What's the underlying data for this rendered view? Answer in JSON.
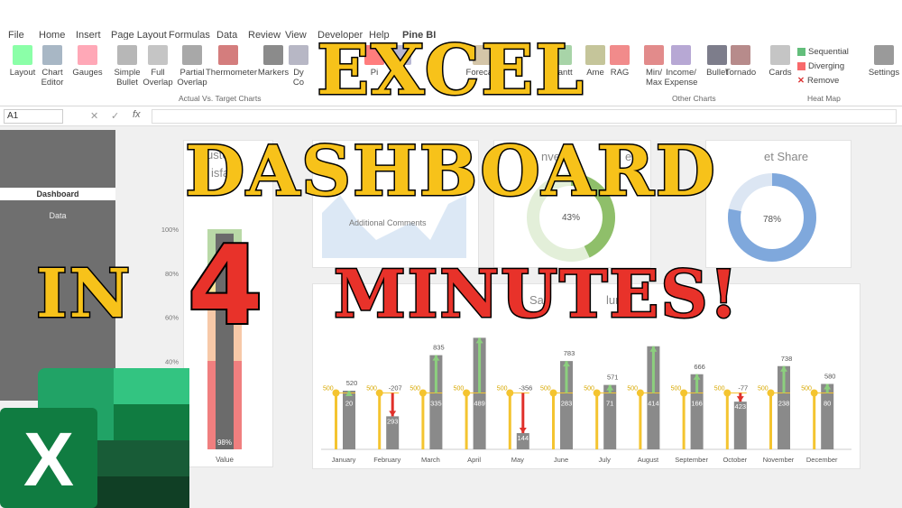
{
  "menu": [
    "File",
    "Home",
    "Insert",
    "Page Layout",
    "Formulas",
    "Data",
    "Review",
    "View",
    "Developer",
    "Help",
    "Pine BI"
  ],
  "ribbon": {
    "buttons": [
      [
        "Layout"
      ],
      [
        "Chart",
        "Editor"
      ],
      [
        "Gauges"
      ],
      [
        "Simple",
        "Bullet"
      ],
      [
        "Full",
        "Overlap"
      ],
      [
        "Partial",
        "Overlap"
      ],
      [
        "Thermometer"
      ],
      [
        "Markers"
      ],
      [
        "Dy",
        "Co"
      ],
      [
        "Pi"
      ],
      [
        "Ad"
      ],
      [
        "Forecast"
      ],
      [
        "Gantt"
      ],
      [
        "Ame"
      ],
      [
        "RAG"
      ],
      [
        "Min/",
        "Max"
      ],
      [
        "Income/",
        "Expense"
      ],
      [
        "Bullet"
      ],
      [
        "Tornado"
      ],
      [
        "Cards"
      ],
      [
        "Settings"
      ]
    ],
    "group_actual": "Actual Vs. Target Charts",
    "group_other": "Other Charts",
    "group_heat": "Heat Map",
    "heat": [
      "Sequential",
      "Diverging",
      "Remove"
    ]
  },
  "namebox": "A1",
  "fx": "fx",
  "sidebar": {
    "items": [
      "Dashboard",
      "Data"
    ]
  },
  "cards": {
    "customer_title_fragment": "ustom",
    "customer_sub_fragment": "isfa",
    "comments": "Additional Comments",
    "conversion_fragment": "nvers",
    "conversion_fragment2": "e",
    "market_fragment": "et Share",
    "donut1": "43%",
    "donut2": "78%",
    "sales_fragment": "Sa",
    "sales_fragment2": "lum",
    "value_label": "Value",
    "bar_label": "98%"
  },
  "chart_data": [
    {
      "type": "bar",
      "categories": [
        "Value"
      ],
      "values": [
        98
      ],
      "ylim": [
        0,
        100
      ],
      "yticks": [
        "100%",
        "80%",
        "60%",
        "40%"
      ],
      "data_labels": [
        "98%"
      ]
    },
    {
      "type": "pie",
      "values": [
        43,
        57
      ],
      "data_labels": [
        "43%"
      ]
    },
    {
      "type": "pie",
      "values": [
        78,
        22
      ],
      "data_labels": [
        "78%"
      ]
    },
    {
      "type": "bar",
      "categories": [
        "January",
        "February",
        "March",
        "April",
        "May",
        "June",
        "July",
        "August",
        "September",
        "October",
        "November",
        "December"
      ],
      "series": [
        {
          "values": [
            500,
            500,
            500,
            500,
            500,
            500,
            500,
            500,
            500,
            500,
            500,
            500
          ]
        },
        {
          "values": [
            520,
            293,
            835,
            989,
            144,
            783,
            571,
            914,
            666,
            423,
            738,
            580
          ]
        },
        {
          "values": [
            20,
            -207,
            335,
            489,
            -356,
            283,
            71,
            414,
            166,
            -77,
            238,
            80
          ]
        }
      ],
      "bar_labels": [
        "20",
        "293",
        "335",
        "489",
        "144",
        "283",
        "71",
        "414",
        "166",
        "423",
        "238",
        "80"
      ],
      "top_labels": [
        "520",
        "-207",
        "835",
        "",
        "-356",
        "783",
        "571",
        "",
        "666",
        "-77",
        "738",
        "580"
      ],
      "target_label": "500"
    }
  ],
  "headline": {
    "line1": "EXCEL",
    "line2": "DASHBOARD",
    "line3a": "IN",
    "line3b": "4",
    "line3c": "MINUTES!"
  },
  "logo_letter": "X",
  "colors": {
    "title_yellow": "#f7c21a",
    "title_red": "#e8322a",
    "excel_green": "#1d6f42"
  }
}
